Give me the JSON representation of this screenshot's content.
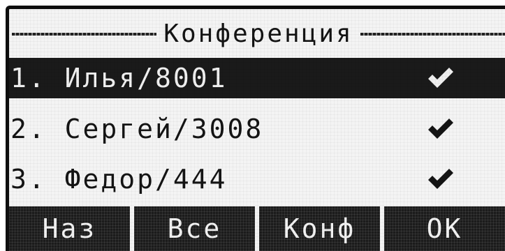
{
  "header": {
    "title": "Конференция"
  },
  "list": {
    "items": [
      {
        "label": "1. Илья/8001",
        "checked": true,
        "selected": true,
        "icon": "checkmark-icon"
      },
      {
        "label": "2. Сергей/3008",
        "checked": true,
        "selected": false,
        "icon": "checkmark-icon"
      },
      {
        "label": "3. Федор/444",
        "checked": true,
        "selected": false,
        "icon": "checkmark-icon"
      }
    ]
  },
  "softkeys": {
    "back_label": "Наз",
    "all_label": "Все",
    "conf_label": "Конф",
    "ok_label": "ОК"
  },
  "colors": {
    "lcd_background": "#f4f4f4",
    "foreground": "#141414",
    "highlight": "#1a1a1a"
  }
}
